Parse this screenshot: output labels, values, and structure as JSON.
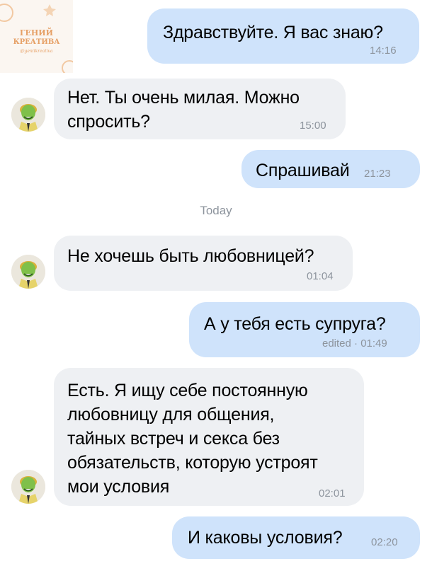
{
  "logo": {
    "line1": "ГЕНИЙ",
    "line2": "КРЕАТИВА",
    "line3": "@geniikreativa"
  },
  "date_separator": "Today",
  "messages": [
    {
      "direction": "out",
      "text": "Здравствуйте. Я вас знаю?",
      "time": "14:16"
    },
    {
      "direction": "in",
      "text": "Нет. Ты очень милая. Можно\nспросить?",
      "time": "15:00"
    },
    {
      "direction": "out",
      "text": "Спрашивай",
      "time": "21:23"
    },
    {
      "direction": "in",
      "text": "Не хочешь быть любовницей?",
      "time": "01:04"
    },
    {
      "direction": "out",
      "text": "А у тебя есть супруга?",
      "time": "edited · 01:49"
    },
    {
      "direction": "in",
      "text": "Есть. Я ищу себе постоянную\nлюбовницу для общения,\nтайных встреч и секса без\nобязательств, которую устроят\nмои условия",
      "time": "02:01"
    },
    {
      "direction": "out",
      "text": "И каковы условия?",
      "time": "02:20"
    }
  ],
  "colors": {
    "incoming_bubble": "#eef0f3",
    "outgoing_bubble": "#cfe3fb",
    "meta_text": "#8d949d"
  }
}
